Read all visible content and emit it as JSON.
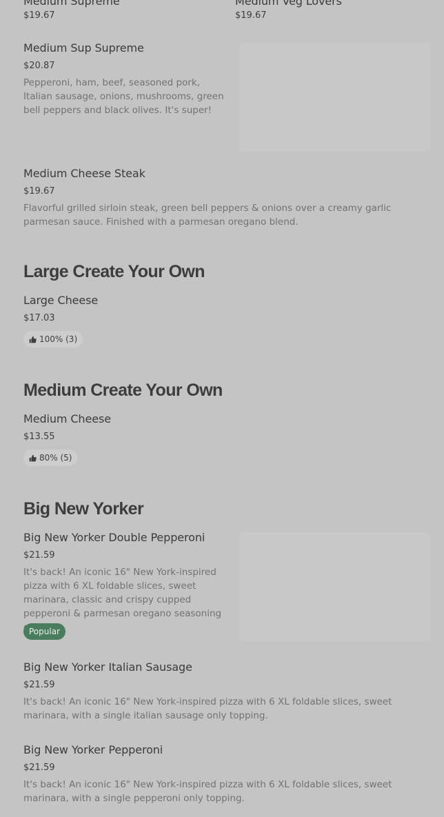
{
  "top_items": [
    {
      "name": "Medium Supreme",
      "price": "$19.67"
    },
    {
      "name": "Medium Veg Lovers",
      "price": "$19.67"
    }
  ],
  "items": {
    "sup_supreme": {
      "name": "Medium Sup Supreme",
      "price": "$20.87",
      "description": "Pepperoni, ham, beef, seasoned pork, Italian sausage, onions, mushrooms, green bell peppers and black olives. It's super!"
    },
    "cheese_steak": {
      "name": "Medium Cheese Steak",
      "price": "$19.67",
      "description": "Flavorful grilled sirloin steak, green bell peppers & onions over a creamy garlic parmesan sauce. Finished with a parmesan oregano blend."
    }
  },
  "sections": {
    "large_create": {
      "title": "Large Create Your Own",
      "item": {
        "name": "Large Cheese",
        "price": "$17.03",
        "rating": "100% (3)"
      }
    },
    "medium_create": {
      "title": "Medium Create Your Own",
      "item": {
        "name": "Medium Cheese",
        "price": "$13.55",
        "rating": "80% (5)"
      }
    },
    "big_new_yorker": {
      "title": "Big New Yorker",
      "items": [
        {
          "name": "Big New Yorker Double Pepperoni",
          "price": "$21.59",
          "description": "It's back! An iconic 16\" New York-inspired pizza with 6 XL foldable slices, sweet marinara, classic and crispy cupped pepperoni & parmesan oregano seasoning on top.",
          "badge": "Popular"
        },
        {
          "name": "Big New Yorker Italian Sausage",
          "price": "$21.59",
          "description": "It's back! An iconic 16\" New York-inspired pizza with 6 XL foldable slices, sweet marinara, with a single italian sausage only topping."
        },
        {
          "name": "Big New Yorker Pepperoni",
          "price": "$21.59",
          "description": "It's back! An iconic 16\" New York-inspired pizza with 6 XL foldable slices, sweet marinara, with a single pepperoni only topping."
        }
      ]
    }
  },
  "icons": {
    "rating": "thumbs-up-icon"
  },
  "colors": {
    "background": "#c4c4c4",
    "badge": "#4a7d5e"
  }
}
